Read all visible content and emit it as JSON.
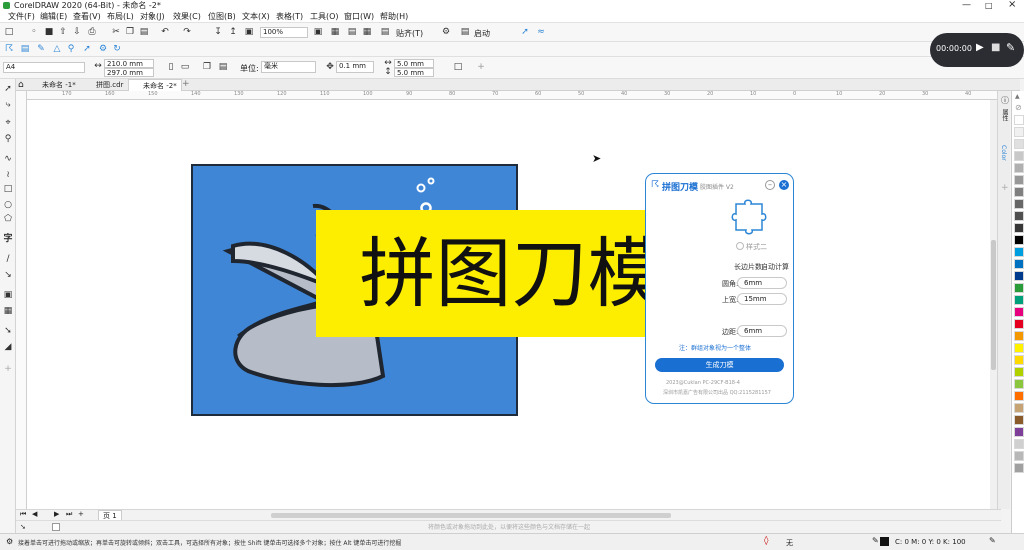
{
  "window": {
    "title": "CorelDRAW 2020 (64-Bit) - 未命名 -2*"
  },
  "menu": [
    "文件(F)",
    "编辑(E)",
    "查看(V)",
    "布局(L)",
    "对象(J)",
    "效果(C)",
    "位图(B)",
    "文本(X)",
    "表格(T)",
    "工具(O)",
    "窗口(W)",
    "帮助(H)"
  ],
  "toolbar": {
    "zoom": "100%",
    "snap_label": "贴齐(T)",
    "launch_label": "启动"
  },
  "property_bar": {
    "page_preset": "A4",
    "width": "210.0 mm",
    "height": "297.0 mm",
    "unit_label": "单位:",
    "unit_value": "毫米",
    "nudge": "0.1 mm",
    "dup_x": "5.0 mm",
    "dup_y": "5.0 mm"
  },
  "tabs": [
    "未命名 -1*",
    "拼图.cdr",
    "未命名 -2*"
  ],
  "ruler_ticks": [
    "170",
    "160",
    "150",
    "140",
    "130",
    "120",
    "110",
    "100",
    "90",
    "80",
    "70",
    "60",
    "50",
    "40",
    "30",
    "20",
    "10",
    "0",
    "10",
    "20",
    "30",
    "40"
  ],
  "recorder": {
    "time": "00:00:00"
  },
  "banner": {
    "text": "拼图刀模"
  },
  "plugin": {
    "title": "拼图刀模",
    "version": "胶图插件 V2",
    "style2_label": "样式二",
    "long_side_label": "长边片数:",
    "long_side_value": "自动计算",
    "corner_label": "圆角:",
    "corner_value": "6mm",
    "top_label": "上宽:",
    "top_value": "15mm",
    "margin_label": "边距:",
    "margin_value": "6mm",
    "note": "注：群组对象视为一个整体",
    "generate_label": "生成刀模",
    "footer1": "2023@Cuklan PC-29CF-B18-4",
    "footer2": "深圳市凯嘉广告有限公司出品 QQ:2115281157"
  },
  "page_nav": {
    "page_label": "页 1"
  },
  "canvas_hint": "将颜色或对象拖动到此处，以便将这些颜色与文档存储在一起",
  "status": {
    "hint": "接着单击可进行拖动或缩放；再单击可旋转或倾斜；双击工具，可选择所有对象；按住 Shift 键单击可选择多个对象；按住 Alt 键单击可进行挖掘",
    "fill_label": "无",
    "color_readout": "C: 0 M: 0 Y: 0 K: 100"
  },
  "docker": {
    "properties_label": "属性",
    "color_label": "Color"
  },
  "colors": {
    "artboard": "#3f86d6",
    "banner": "#fdee00",
    "accent": "#1a6fd2",
    "palette": [
      "#ffffff",
      "#f0f0f0",
      "#e0e0e0",
      "#c8c8c8",
      "#b0b0b0",
      "#989898",
      "#808080",
      "#686868",
      "#505050",
      "#383838",
      "#000000",
      "#00a0e0",
      "#0070c0",
      "#003a8c",
      "#2a9d3a",
      "#00a07a",
      "#e6007e",
      "#e6001f",
      "#f39800",
      "#fff100",
      "#ffd900",
      "#b0d000",
      "#8cc63f",
      "#ff6f00",
      "#c6a375",
      "#8b5a2b",
      "#7d3f98",
      "#d0d0d0",
      "#b8b8b8",
      "#a0a0a0"
    ]
  }
}
